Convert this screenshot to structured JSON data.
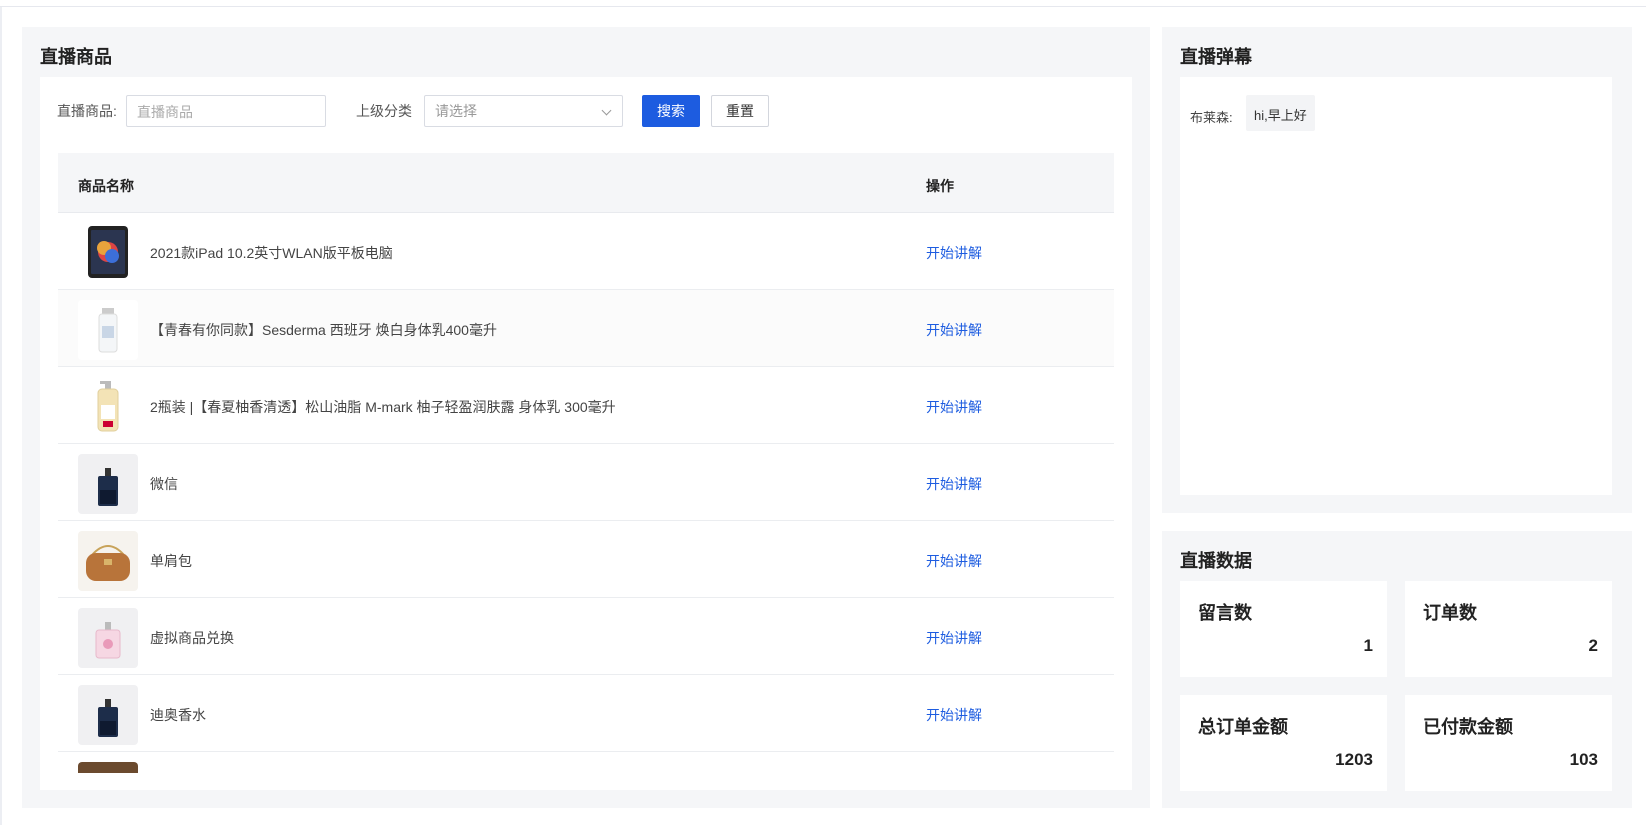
{
  "products_panel": {
    "title": "直播商品",
    "filters": {
      "product_label": "直播商品:",
      "product_placeholder": "直播商品",
      "category_label": "上级分类",
      "category_placeholder": "请选择",
      "search_button": "搜索",
      "reset_button": "重置"
    },
    "table": {
      "columns": [
        "商品名称",
        "操作"
      ],
      "rows": [
        {
          "name": "2021款iPad 10.2英寸WLAN版平板电脑",
          "action": "开始讲解",
          "thumb": "ipad"
        },
        {
          "name": "【青春有你同款】Sesderma 西班牙 焕白身体乳400毫升",
          "action": "开始讲解",
          "thumb": "lotion-bottle"
        },
        {
          "name": "2瓶装 |【春夏柚香清透】松山油脂 M-mark 柚子轻盈润肤露 身体乳 300毫升",
          "action": "开始讲解",
          "thumb": "pump-bottle"
        },
        {
          "name": "微信",
          "action": "开始讲解",
          "thumb": "dior-perfume-dark"
        },
        {
          "name": "单肩包",
          "action": "开始讲解",
          "thumb": "shoulder-bag"
        },
        {
          "name": "虚拟商品兑换",
          "action": "开始讲解",
          "thumb": "dior-perfume-pink"
        },
        {
          "name": "迪奥香水",
          "action": "开始讲解",
          "thumb": "dior-perfume-dark"
        }
      ]
    }
  },
  "danmaku_panel": {
    "title": "直播弹幕",
    "messages": [
      {
        "user": "布莱森:",
        "text": "hi,早上好"
      }
    ]
  },
  "stats_panel": {
    "title": "直播数据",
    "items": [
      {
        "label": "留言数",
        "value": "1"
      },
      {
        "label": "订单数",
        "value": "2"
      },
      {
        "label": "总订单金额",
        "value": "1203"
      },
      {
        "label": "已付款金额",
        "value": "103"
      }
    ]
  },
  "colors": {
    "primary": "#1d5ce0",
    "panel_bg": "#f5f6f8"
  }
}
